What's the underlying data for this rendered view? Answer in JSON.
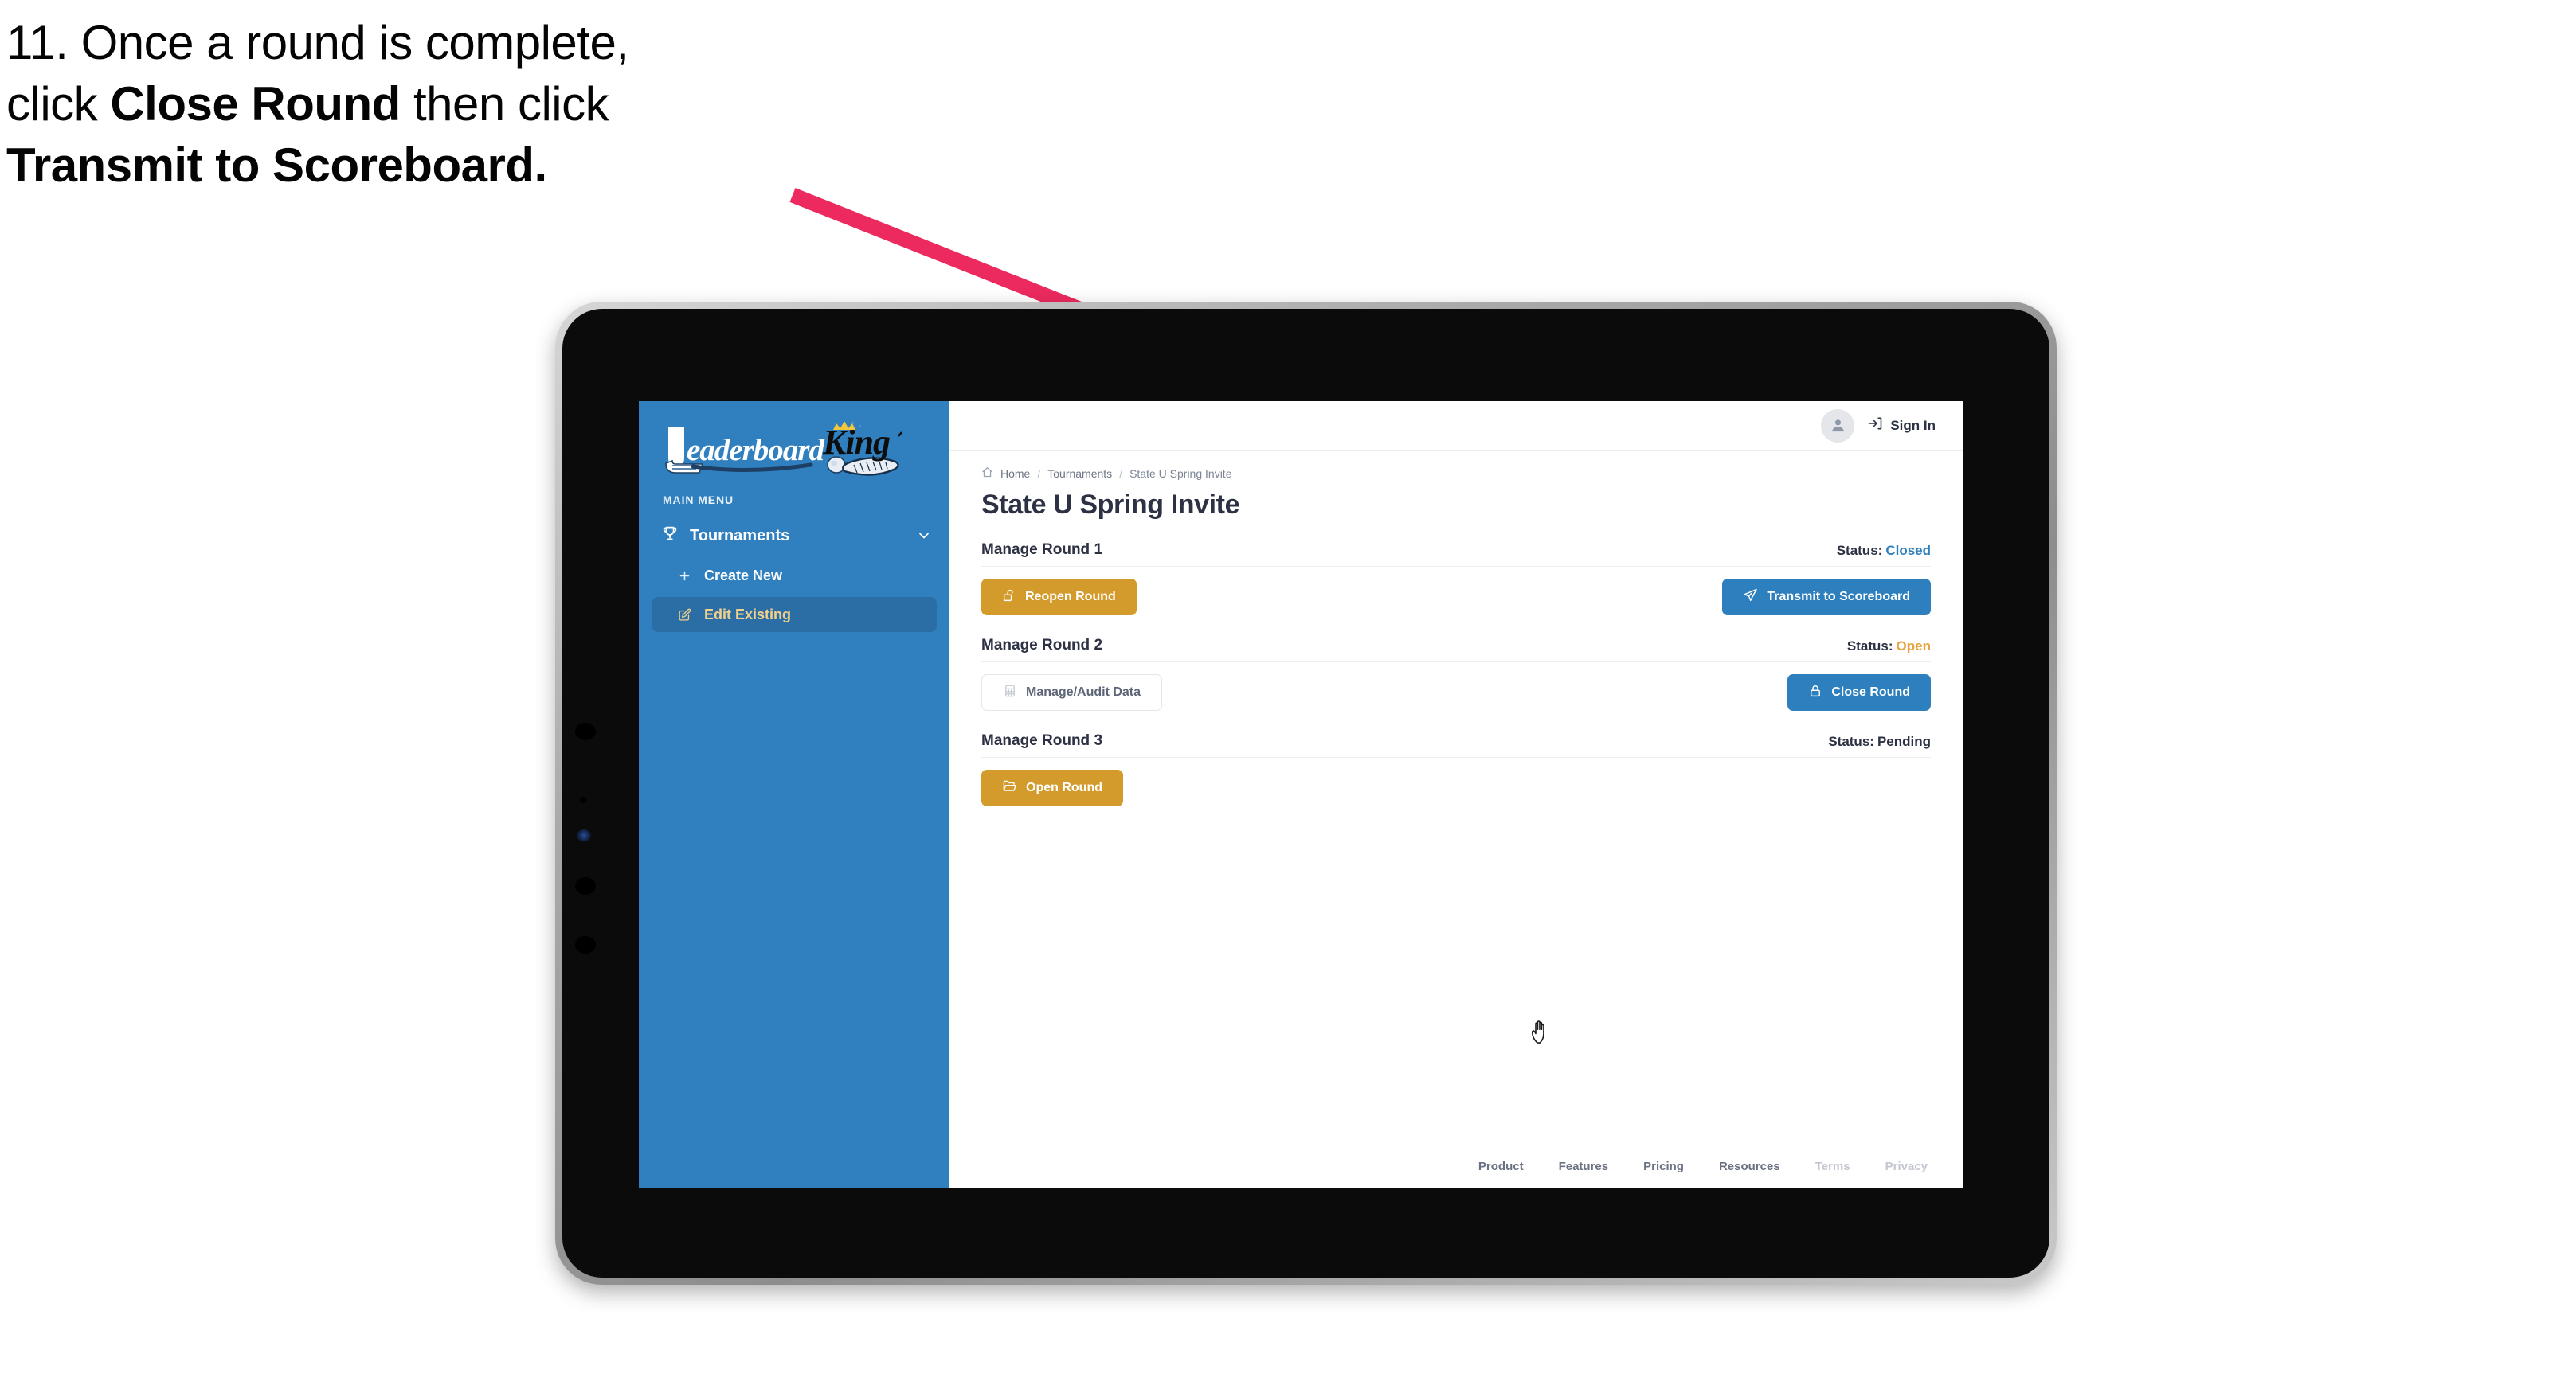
{
  "caption": {
    "line1_plain": "11. Once a round is complete,",
    "line2_pre": "click ",
    "line2_bold": "Close Round",
    "line2_post": " then click",
    "line3_bold": "Transmit to Scoreboard."
  },
  "annotation": {
    "arrow_color": "#EC2A5F"
  },
  "sidebar": {
    "logo_text_left": "Leaderboard",
    "logo_text_right": "King",
    "section_label": "MAIN MENU",
    "nav": [
      {
        "label": "Tournaments",
        "icon": "trophy-icon",
        "chevron": "chevron-down-icon"
      }
    ],
    "sub_items": [
      {
        "label": "Create New",
        "icon": "plus-icon",
        "active": false
      },
      {
        "label": "Edit Existing",
        "icon": "edit-pencil-icon",
        "active": true
      }
    ],
    "bg_color": "#3080BF",
    "active_bg_color": "#2A6EA5",
    "active_text_color": "#F1D08C"
  },
  "topbar": {
    "avatar_icon": "user-avatar-icon",
    "signin_icon": "sign-in-arrow-icon",
    "signin_label": "Sign In"
  },
  "breadcrumb": {
    "home_icon": "home-icon",
    "items": [
      "Home",
      "Tournaments",
      "State U Spring Invite"
    ],
    "separator": "/"
  },
  "page": {
    "title": "State U Spring Invite"
  },
  "rounds": [
    {
      "title": "Manage Round 1",
      "status_label": "Status:",
      "status_value": "Closed",
      "status_color": "#2D7FBE",
      "left_button": {
        "label": "Reopen Round",
        "icon": "unlock-icon",
        "style": "gold"
      },
      "right_button": {
        "label": "Transmit to Scoreboard",
        "icon": "paper-plane-icon",
        "style": "blue"
      }
    },
    {
      "title": "Manage Round 2",
      "status_label": "Status:",
      "status_value": "Open",
      "status_color": "#E8A33D",
      "left_button": {
        "label": "Manage/Audit Data",
        "icon": "table-grid-icon",
        "style": "ghost"
      },
      "right_button": {
        "label": "Close Round",
        "icon": "lock-icon",
        "style": "blue"
      }
    },
    {
      "title": "Manage Round 3",
      "status_label": "Status:",
      "status_value": "Pending",
      "status_color": "#2C3143",
      "left_button": {
        "label": "Open Round",
        "icon": "folder-open-icon",
        "style": "gold"
      },
      "right_button": null
    }
  ],
  "footer": {
    "links": [
      {
        "label": "Product",
        "muted": false
      },
      {
        "label": "Features",
        "muted": false
      },
      {
        "label": "Pricing",
        "muted": false
      },
      {
        "label": "Resources",
        "muted": false
      },
      {
        "label": "Terms",
        "muted": true
      },
      {
        "label": "Privacy",
        "muted": true
      }
    ]
  },
  "cursor": {
    "icon": "pointing-hand-cursor"
  }
}
